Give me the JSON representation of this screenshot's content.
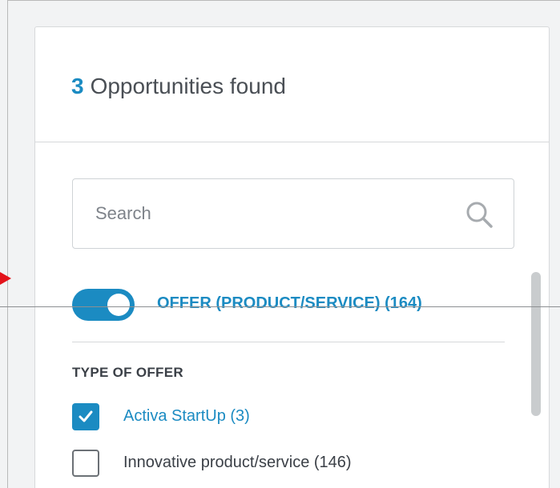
{
  "results": {
    "count": "3",
    "label": "Opportunities found"
  },
  "search": {
    "placeholder": "Search",
    "value": "",
    "icon": "search-icon"
  },
  "toggle": {
    "on": true,
    "label": "OFFER (PRODUCT/SERVICE) (164)"
  },
  "filter_section": {
    "heading": "TYPE OF OFFER",
    "options": [
      {
        "label": "Activa StartUp (3)",
        "checked": true
      },
      {
        "label": "Innovative product/service (146)",
        "checked": false
      }
    ]
  },
  "colors": {
    "accent": "#1b8bc2",
    "text": "#3b4047",
    "border": "#d7d9db",
    "annotation_arrow": "#e3131b"
  }
}
